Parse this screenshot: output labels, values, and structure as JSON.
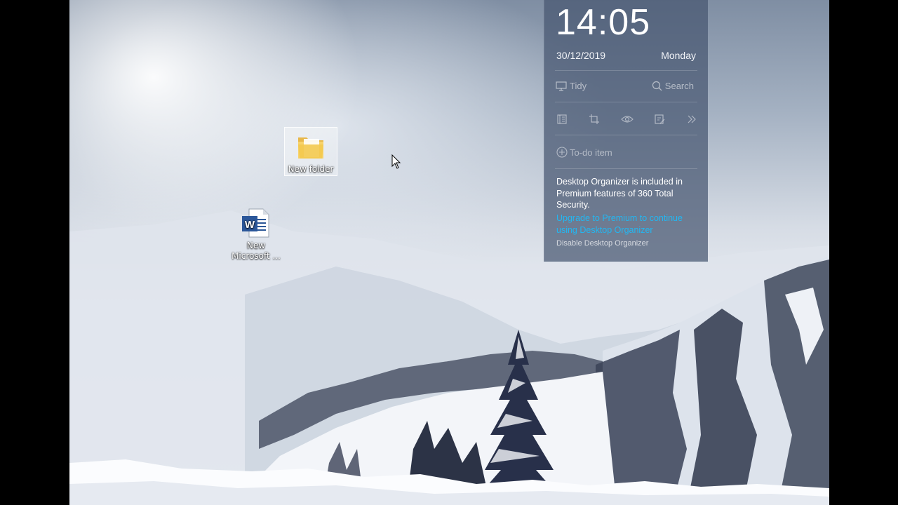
{
  "desktop": {
    "icons": [
      {
        "label": "New folder",
        "icon": "folder-icon",
        "selected": true
      },
      {
        "label_line1": "New",
        "label_line2": "Microsoft ...",
        "icon": "word-document-icon",
        "selected": false
      }
    ]
  },
  "organizer": {
    "time": "14:05",
    "date": "30/12/2019",
    "weekday": "Monday",
    "tidy_label": "Tidy",
    "search_label": "Search",
    "toolbar_icons": [
      "notes-icon",
      "crop-icon",
      "eye-icon",
      "edit-icon",
      "double-chevron-right-icon"
    ],
    "todo_label": "To-do item",
    "notice": "Desktop Organizer is included in Premium features of 360 Total Security.",
    "upgrade_link": "Upgrade to Premium to continue using Desktop Organizer",
    "disable_link": "Disable Desktop Organizer",
    "link_color": "#22b7f2"
  }
}
